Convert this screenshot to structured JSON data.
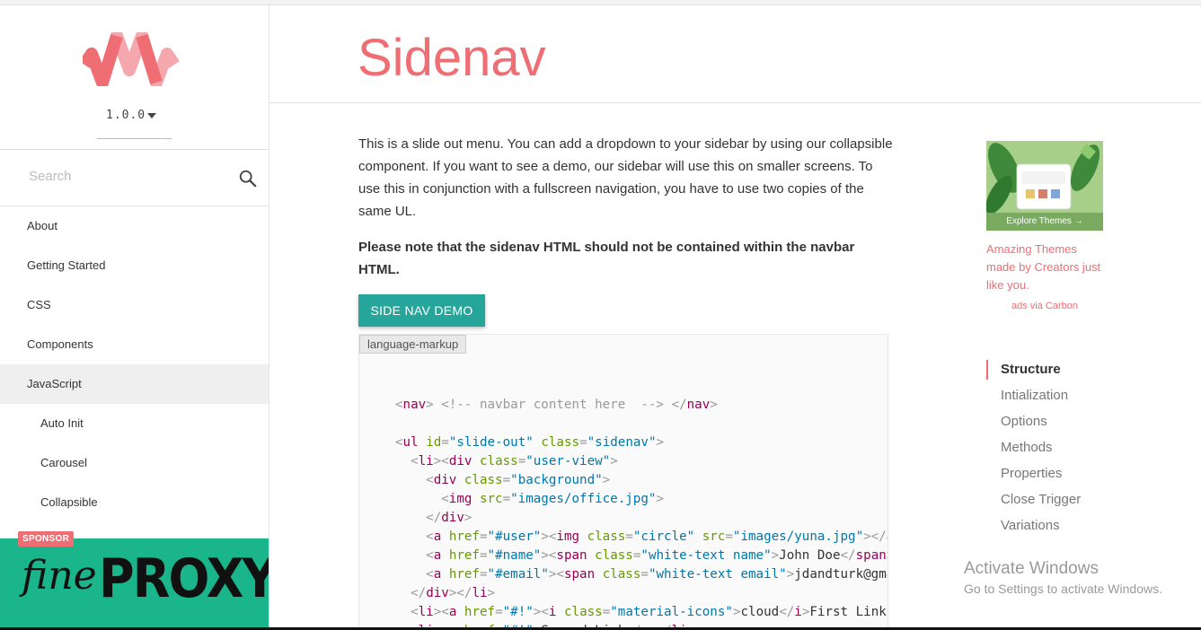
{
  "sidebar": {
    "version": "1.0.0",
    "search_placeholder": "Search",
    "nav_items": [
      {
        "label": "About"
      },
      {
        "label": "Getting Started"
      },
      {
        "label": "CSS"
      },
      {
        "label": "Components"
      },
      {
        "label": "JavaScript"
      },
      {
        "label": "Auto Init"
      },
      {
        "label": "Carousel"
      },
      {
        "label": "Collapsible"
      }
    ],
    "sponsor": {
      "badge": "SPONSOR",
      "brand_fine": "fine",
      "brand_proxy": "PROXY"
    }
  },
  "header": {
    "title": "Sidenav"
  },
  "main": {
    "intro": "This is a slide out menu. You can add a dropdown to your sidebar by using our collapsible component. If you want to see a demo, our sidebar will use this on smaller screens. To use this in conjunction with a fullscreen navigation, you have to use two copies of the same UL.",
    "note": "Please note that the sidenav HTML should not be contained within the navbar HTML.",
    "demo_button": "SIDE NAV DEMO",
    "code_language": "language-markup"
  },
  "ad": {
    "banner_text": "Explore Themes →",
    "text": "Amazing Themes made by Creators just like you.",
    "via": "ads via Carbon"
  },
  "toc": [
    {
      "label": "Structure"
    },
    {
      "label": "Intialization"
    },
    {
      "label": "Options"
    },
    {
      "label": "Methods"
    },
    {
      "label": "Properties"
    },
    {
      "label": "Close Trigger"
    },
    {
      "label": "Variations"
    }
  ],
  "watermark": {
    "line1": "Activate Windows",
    "line2": "Go to Settings to activate Windows."
  },
  "colors": {
    "accent": "#ee6e73",
    "button": "#26a69a",
    "sponsor_bg": "#1bb58b"
  }
}
